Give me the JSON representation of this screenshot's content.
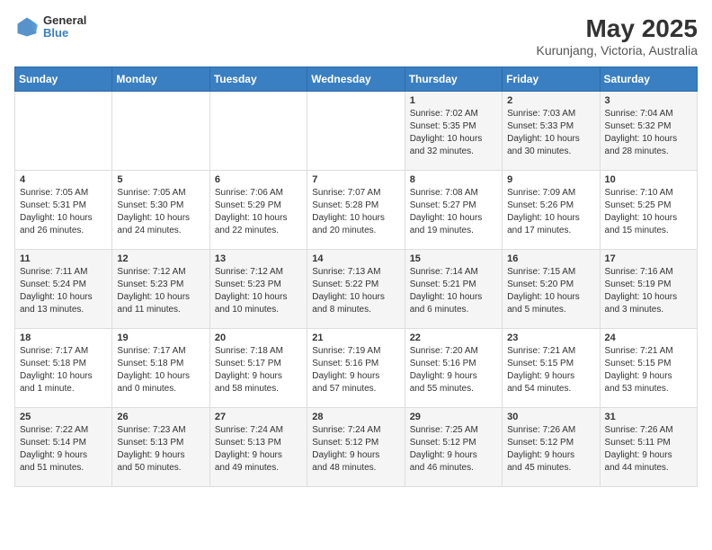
{
  "header": {
    "logo_line1": "General",
    "logo_line2": "Blue",
    "title": "May 2025",
    "subtitle": "Kurunjang, Victoria, Australia"
  },
  "columns": [
    "Sunday",
    "Monday",
    "Tuesday",
    "Wednesday",
    "Thursday",
    "Friday",
    "Saturday"
  ],
  "weeks": [
    [
      {
        "day": "",
        "info": ""
      },
      {
        "day": "",
        "info": ""
      },
      {
        "day": "",
        "info": ""
      },
      {
        "day": "",
        "info": ""
      },
      {
        "day": "1",
        "info": "Sunrise: 7:02 AM\nSunset: 5:35 PM\nDaylight: 10 hours\nand 32 minutes."
      },
      {
        "day": "2",
        "info": "Sunrise: 7:03 AM\nSunset: 5:33 PM\nDaylight: 10 hours\nand 30 minutes."
      },
      {
        "day": "3",
        "info": "Sunrise: 7:04 AM\nSunset: 5:32 PM\nDaylight: 10 hours\nand 28 minutes."
      }
    ],
    [
      {
        "day": "4",
        "info": "Sunrise: 7:05 AM\nSunset: 5:31 PM\nDaylight: 10 hours\nand 26 minutes."
      },
      {
        "day": "5",
        "info": "Sunrise: 7:05 AM\nSunset: 5:30 PM\nDaylight: 10 hours\nand 24 minutes."
      },
      {
        "day": "6",
        "info": "Sunrise: 7:06 AM\nSunset: 5:29 PM\nDaylight: 10 hours\nand 22 minutes."
      },
      {
        "day": "7",
        "info": "Sunrise: 7:07 AM\nSunset: 5:28 PM\nDaylight: 10 hours\nand 20 minutes."
      },
      {
        "day": "8",
        "info": "Sunrise: 7:08 AM\nSunset: 5:27 PM\nDaylight: 10 hours\nand 19 minutes."
      },
      {
        "day": "9",
        "info": "Sunrise: 7:09 AM\nSunset: 5:26 PM\nDaylight: 10 hours\nand 17 minutes."
      },
      {
        "day": "10",
        "info": "Sunrise: 7:10 AM\nSunset: 5:25 PM\nDaylight: 10 hours\nand 15 minutes."
      }
    ],
    [
      {
        "day": "11",
        "info": "Sunrise: 7:11 AM\nSunset: 5:24 PM\nDaylight: 10 hours\nand 13 minutes."
      },
      {
        "day": "12",
        "info": "Sunrise: 7:12 AM\nSunset: 5:23 PM\nDaylight: 10 hours\nand 11 minutes."
      },
      {
        "day": "13",
        "info": "Sunrise: 7:12 AM\nSunset: 5:23 PM\nDaylight: 10 hours\nand 10 minutes."
      },
      {
        "day": "14",
        "info": "Sunrise: 7:13 AM\nSunset: 5:22 PM\nDaylight: 10 hours\nand 8 minutes."
      },
      {
        "day": "15",
        "info": "Sunrise: 7:14 AM\nSunset: 5:21 PM\nDaylight: 10 hours\nand 6 minutes."
      },
      {
        "day": "16",
        "info": "Sunrise: 7:15 AM\nSunset: 5:20 PM\nDaylight: 10 hours\nand 5 minutes."
      },
      {
        "day": "17",
        "info": "Sunrise: 7:16 AM\nSunset: 5:19 PM\nDaylight: 10 hours\nand 3 minutes."
      }
    ],
    [
      {
        "day": "18",
        "info": "Sunrise: 7:17 AM\nSunset: 5:18 PM\nDaylight: 10 hours\nand 1 minute."
      },
      {
        "day": "19",
        "info": "Sunrise: 7:17 AM\nSunset: 5:18 PM\nDaylight: 10 hours\nand 0 minutes."
      },
      {
        "day": "20",
        "info": "Sunrise: 7:18 AM\nSunset: 5:17 PM\nDaylight: 9 hours\nand 58 minutes."
      },
      {
        "day": "21",
        "info": "Sunrise: 7:19 AM\nSunset: 5:16 PM\nDaylight: 9 hours\nand 57 minutes."
      },
      {
        "day": "22",
        "info": "Sunrise: 7:20 AM\nSunset: 5:16 PM\nDaylight: 9 hours\nand 55 minutes."
      },
      {
        "day": "23",
        "info": "Sunrise: 7:21 AM\nSunset: 5:15 PM\nDaylight: 9 hours\nand 54 minutes."
      },
      {
        "day": "24",
        "info": "Sunrise: 7:21 AM\nSunset: 5:15 PM\nDaylight: 9 hours\nand 53 minutes."
      }
    ],
    [
      {
        "day": "25",
        "info": "Sunrise: 7:22 AM\nSunset: 5:14 PM\nDaylight: 9 hours\nand 51 minutes."
      },
      {
        "day": "26",
        "info": "Sunrise: 7:23 AM\nSunset: 5:13 PM\nDaylight: 9 hours\nand 50 minutes."
      },
      {
        "day": "27",
        "info": "Sunrise: 7:24 AM\nSunset: 5:13 PM\nDaylight: 9 hours\nand 49 minutes."
      },
      {
        "day": "28",
        "info": "Sunrise: 7:24 AM\nSunset: 5:12 PM\nDaylight: 9 hours\nand 48 minutes."
      },
      {
        "day": "29",
        "info": "Sunrise: 7:25 AM\nSunset: 5:12 PM\nDaylight: 9 hours\nand 46 minutes."
      },
      {
        "day": "30",
        "info": "Sunrise: 7:26 AM\nSunset: 5:12 PM\nDaylight: 9 hours\nand 45 minutes."
      },
      {
        "day": "31",
        "info": "Sunrise: 7:26 AM\nSunset: 5:11 PM\nDaylight: 9 hours\nand 44 minutes."
      }
    ]
  ]
}
